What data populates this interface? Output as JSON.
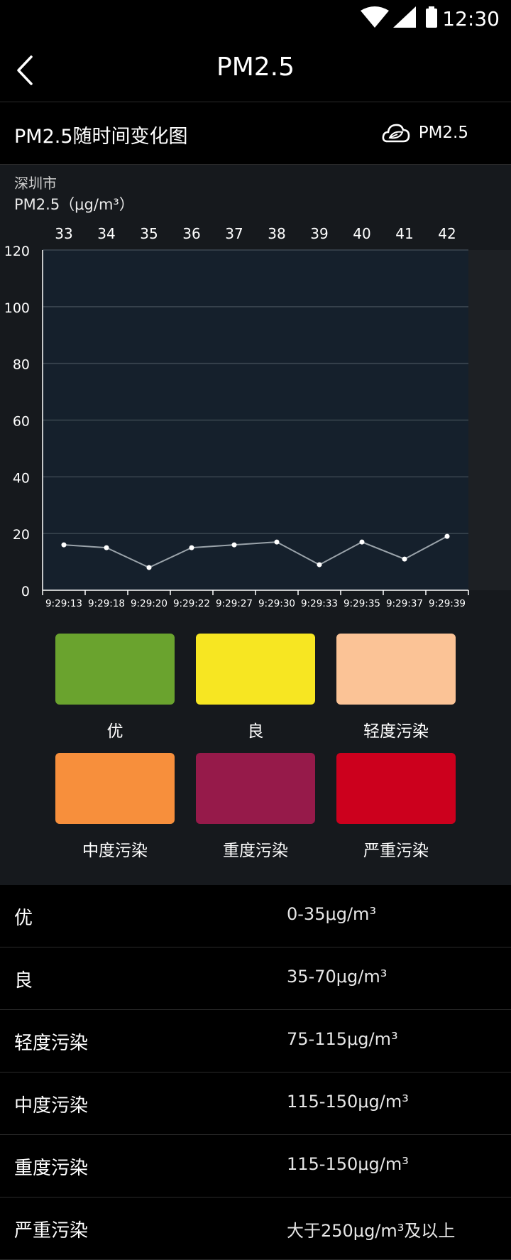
{
  "status": {
    "time": "12:30"
  },
  "header": {
    "title": "PM2.5"
  },
  "section": {
    "title": "PM2.5随时间变化图",
    "tag": "PM2.5"
  },
  "chart_meta": {
    "city": "深圳市",
    "unit": "PM2.5（μg/m³）"
  },
  "chart_data": {
    "type": "line",
    "x": [
      "9:29:13",
      "9:29:18",
      "9:29:20",
      "9:29:22",
      "9:29:27",
      "9:29:30",
      "9:29:33",
      "9:29:35",
      "9:29:37",
      "9:29:39"
    ],
    "top_labels": [
      "33",
      "34",
      "35",
      "36",
      "37",
      "38",
      "39",
      "40",
      "41",
      "42"
    ],
    "values": [
      16,
      15,
      8,
      15,
      16,
      17,
      9,
      17,
      11,
      19
    ],
    "ylim": [
      0,
      120
    ],
    "yticks": [
      0,
      20,
      40,
      60,
      80,
      100,
      120
    ],
    "grid": true,
    "colors": {
      "plot_bg": "#15202c",
      "line": "#9aa3aa",
      "point": "#ffffff",
      "grid": "#3b4650"
    }
  },
  "legend": [
    {
      "label": "优",
      "color": "#6aa32e"
    },
    {
      "label": "良",
      "color": "#f7e622"
    },
    {
      "label": "轻度污染",
      "color": "#fbc396"
    },
    {
      "label": "中度污染",
      "color": "#f78f3c"
    },
    {
      "label": "重度污染",
      "color": "#961a4a"
    },
    {
      "label": "严重污染",
      "color": "#cc001d"
    }
  ],
  "table": [
    {
      "level": "优",
      "range": "0-35μg/m³"
    },
    {
      "level": "良",
      "range": "35-70μg/m³"
    },
    {
      "level": "轻度污染",
      "range": "75-115μg/m³"
    },
    {
      "level": "中度污染",
      "range": "115-150μg/m³"
    },
    {
      "level": "重度污染",
      "range": "115-150μg/m³"
    },
    {
      "level": "严重污染",
      "range": "大于250μg/m³及以上"
    }
  ]
}
